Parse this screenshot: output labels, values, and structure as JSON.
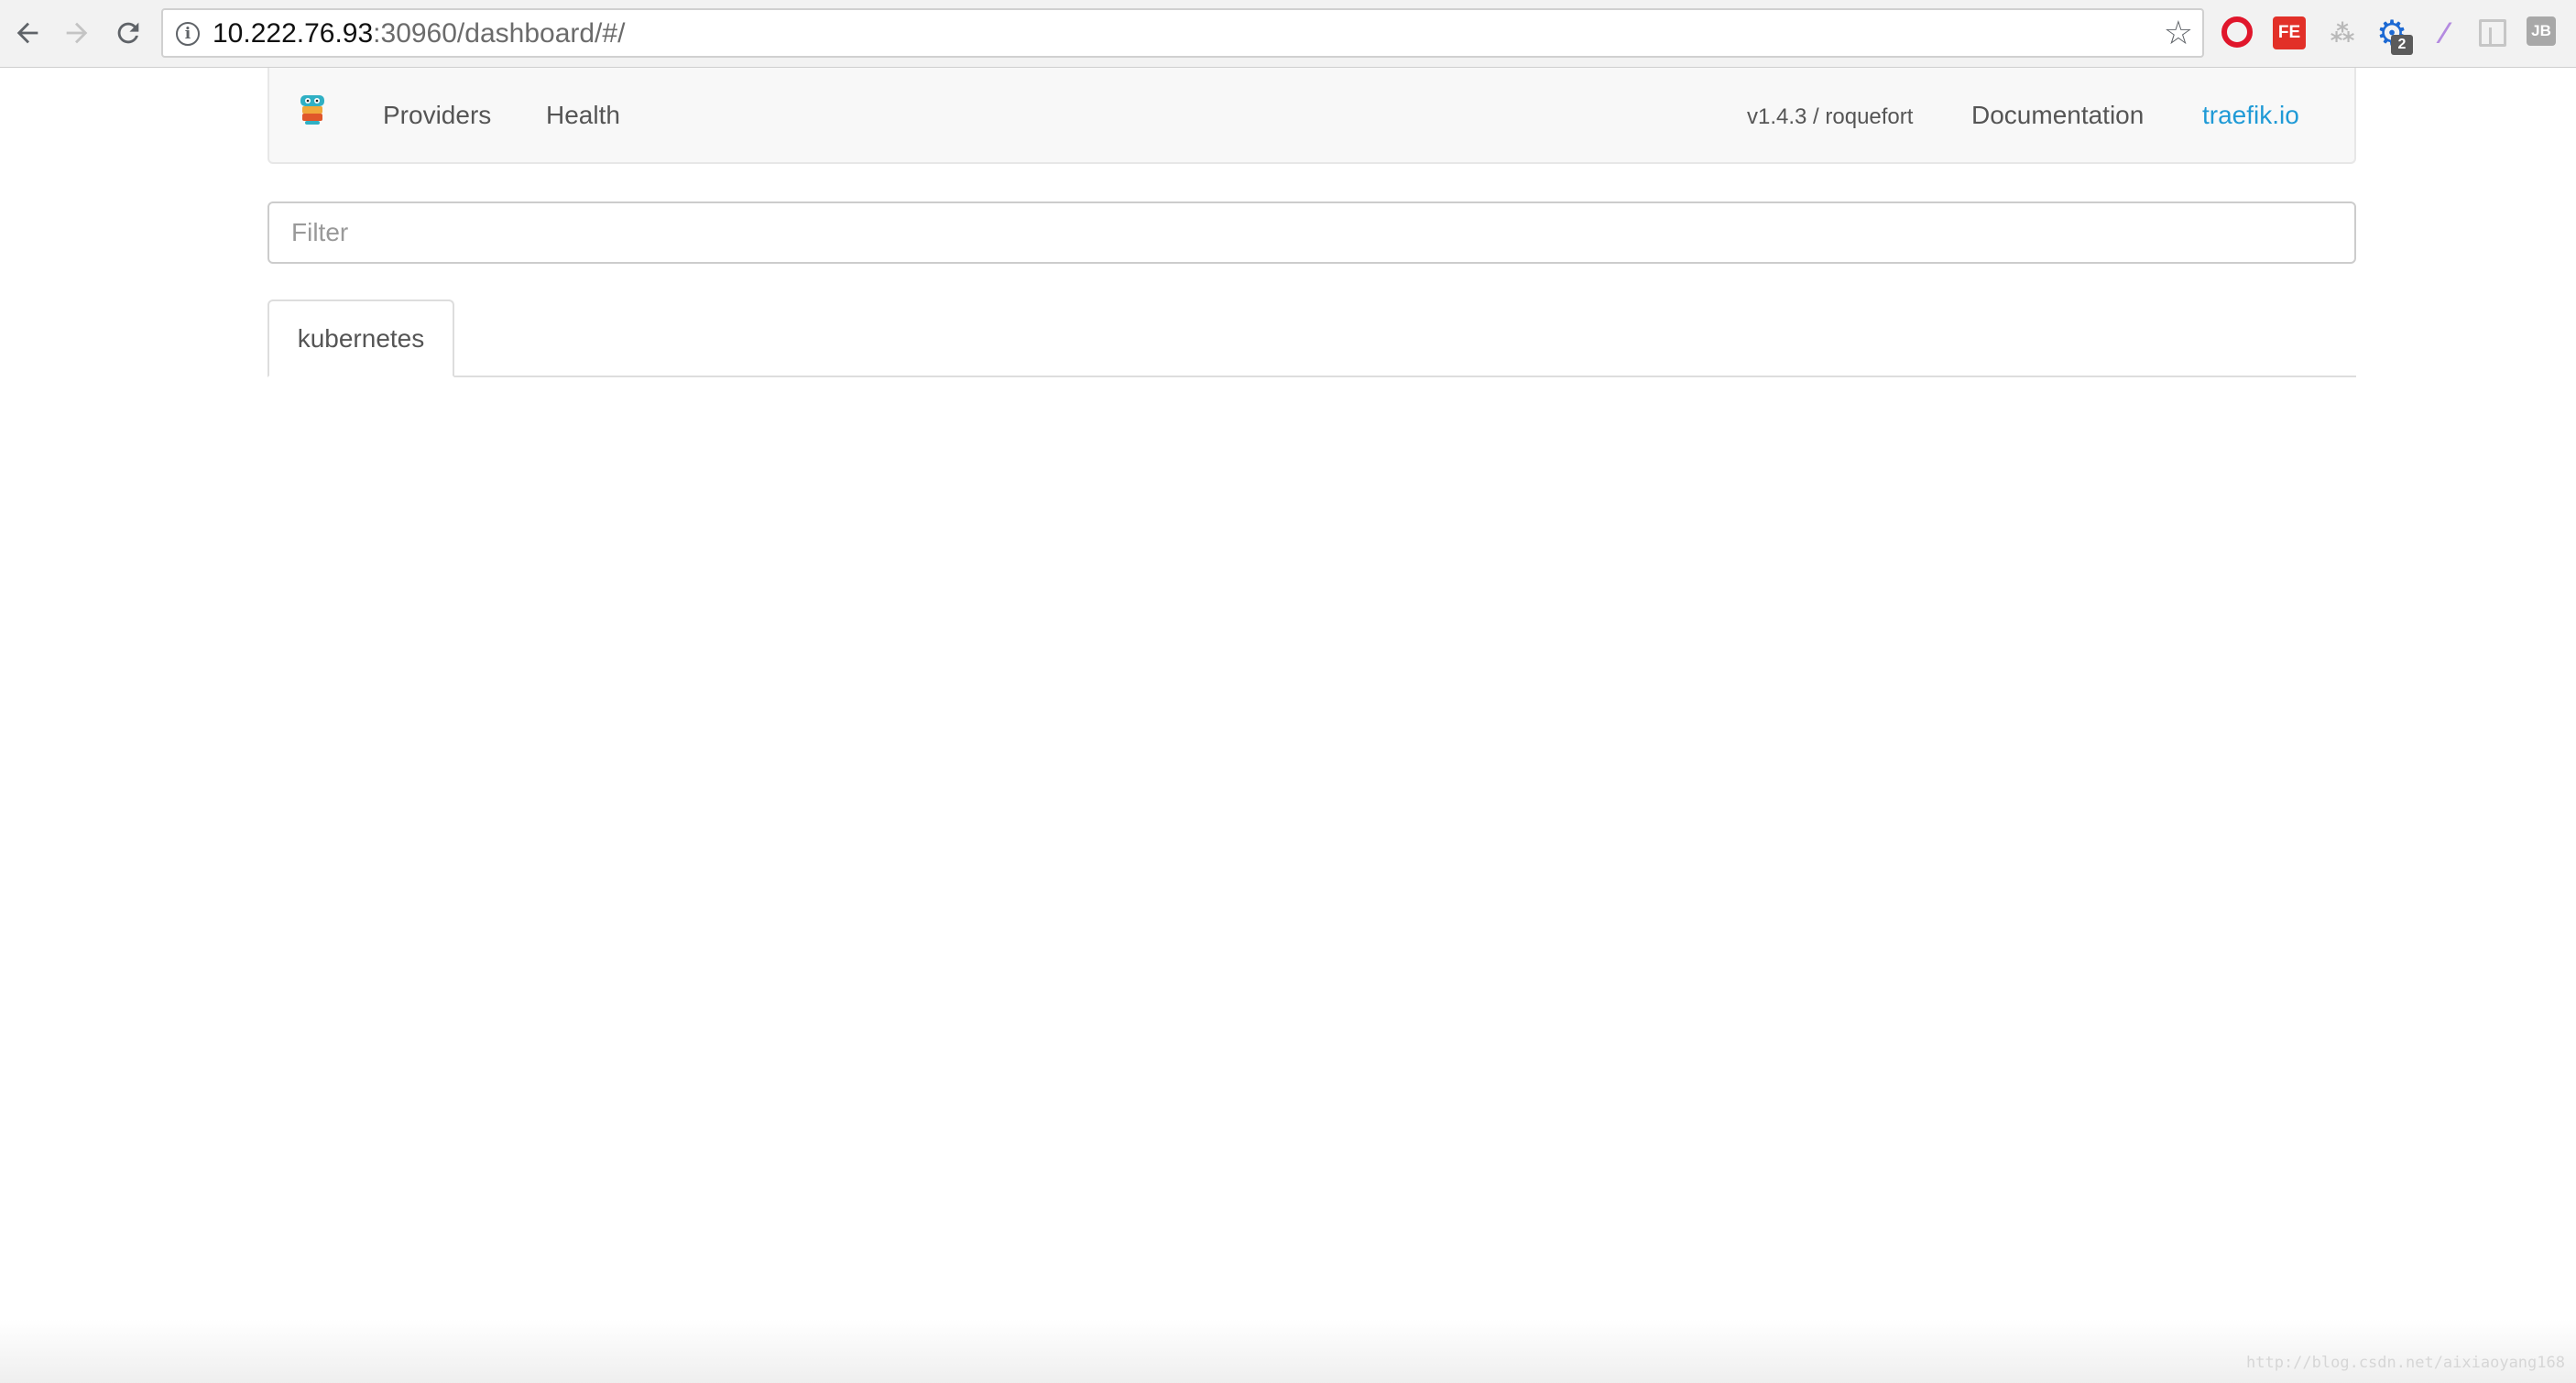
{
  "browser": {
    "url_host": "10.222.76.93",
    "url_path": ":30960/dashboard/#/",
    "extension_badge_count": "2",
    "extensions": {
      "fe_label": "FE",
      "jb_label": "JB"
    },
    "icons": [
      "back-arrow-icon",
      "forward-arrow-icon",
      "reload-icon",
      "info-icon",
      "star-icon",
      "opera-icon",
      "fe-extension-icon",
      "tree-extension-icon",
      "gear-extension-icon",
      "pen-extension-icon",
      "layout-extension-icon",
      "jb-extension-icon"
    ]
  },
  "navbar": {
    "providers_label": "Providers",
    "health_label": "Health",
    "version_label": "v1.4.3 / roquefort",
    "documentation_label": "Documentation",
    "traefik_link_label": "traefik.io",
    "link_color": "#1f9ad6"
  },
  "filter": {
    "placeholder": "Filter",
    "value": ""
  },
  "tabs": [
    {
      "label": "kubernetes",
      "active": true
    }
  ],
  "watermark": "http://blog.csdn.net/aixiaoyang168"
}
